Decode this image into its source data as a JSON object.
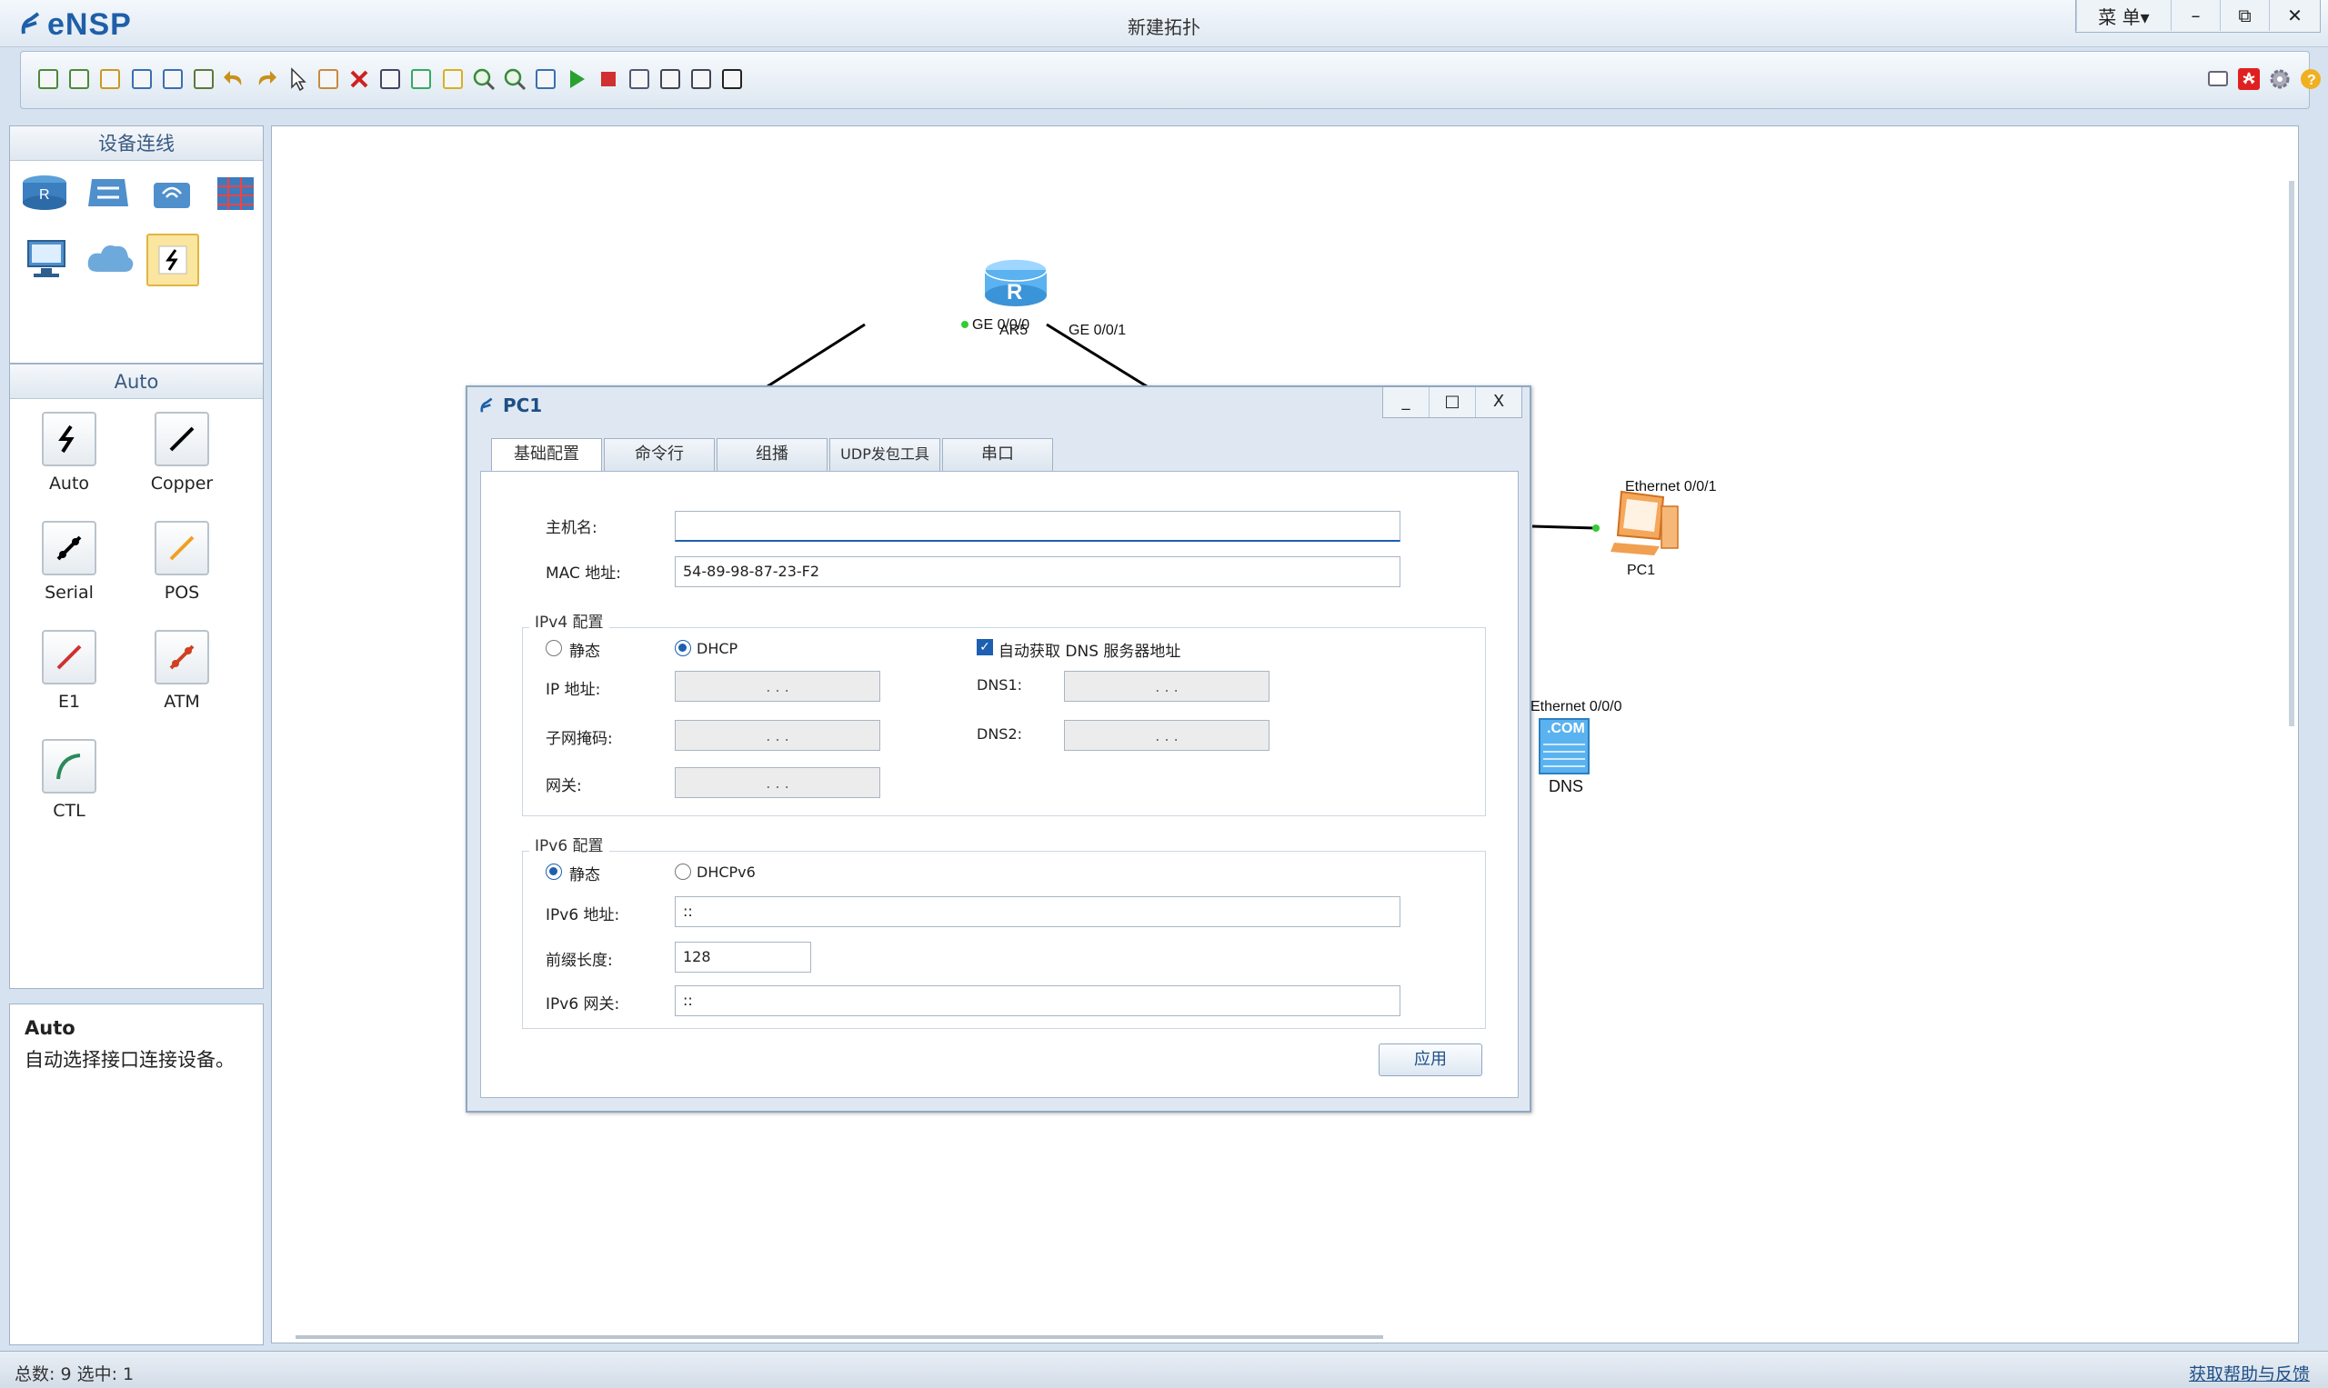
{
  "app": {
    "name": "eNSP",
    "document_title": "新建拓扑",
    "menu_label": "菜 单▾",
    "minimize": "–",
    "restore": "⧉",
    "close": "✕"
  },
  "toolbar": {
    "icons": [
      "new-topology-icon",
      "new-example-icon",
      "open-icon",
      "save-icon",
      "save-as-icon",
      "print-icon",
      "undo-icon",
      "redo-icon",
      "select-icon",
      "hand-icon",
      "delete-icon",
      "delete-link-icon",
      "text-icon",
      "rectangle-icon",
      "zoom-in-icon",
      "zoom-out-icon",
      "fit-icon",
      "start-device-icon",
      "stop-device-icon",
      "capture-icon",
      "topology-icon",
      "grid-icon",
      "console-icon"
    ],
    "right_icons": [
      "chat-icon",
      "huawei-logo-icon",
      "settings-icon",
      "help-icon"
    ]
  },
  "left": {
    "devices_header": "设备连线",
    "auto_header": "Auto",
    "links": [
      {
        "label": "Auto"
      },
      {
        "label": "Copper"
      },
      {
        "label": "Serial"
      },
      {
        "label": "POS"
      },
      {
        "label": "E1"
      },
      {
        "label": "ATM"
      },
      {
        "label": "CTL"
      }
    ],
    "info_title": "Auto",
    "info_text": "自动选择接口连接设备。"
  },
  "topology": {
    "router": {
      "name": "AR5",
      "port_left": "GE 0/0/0",
      "port_right": "GE 0/0/1"
    },
    "pc": {
      "name": "PC1",
      "port": "Ethernet 0/0/1"
    },
    "dns": {
      "name": "DNS",
      "port": "Ethernet 0/0/0",
      "badge": ".COM"
    }
  },
  "dialog": {
    "title": "PC1",
    "min": "_",
    "max": "□",
    "close": "X",
    "tabs": [
      "基础配置",
      "命令行",
      "组播",
      "UDP发包工具",
      "串口"
    ],
    "hostname_label": "主机名:",
    "hostname_value": "",
    "mac_label": "MAC 地址:",
    "mac_value": "54-89-98-87-23-F2",
    "ipv4": {
      "title": "IPv4 配置",
      "static": "静态",
      "dhcp": "DHCP",
      "auto_dns": "自动获取 DNS 服务器地址",
      "ip_label": "IP 地址:",
      "mask_label": "子网掩码:",
      "gw_label": "网关:",
      "dns1_label": "DNS1:",
      "dns2_label": "DNS2:",
      "dots": ". . ."
    },
    "ipv6": {
      "title": "IPv6 配置",
      "static": "静态",
      "dhcpv6": "DHCPv6",
      "ip_label": "IPv6 地址:",
      "ip_value": "::",
      "prefix_label": "前缀长度:",
      "prefix_value": "128",
      "gw_label": "IPv6 网关:",
      "gw_value": "::"
    },
    "apply": "应用"
  },
  "status": {
    "left": "总数: 9 选中: 1",
    "right": "获取帮助与反馈"
  }
}
